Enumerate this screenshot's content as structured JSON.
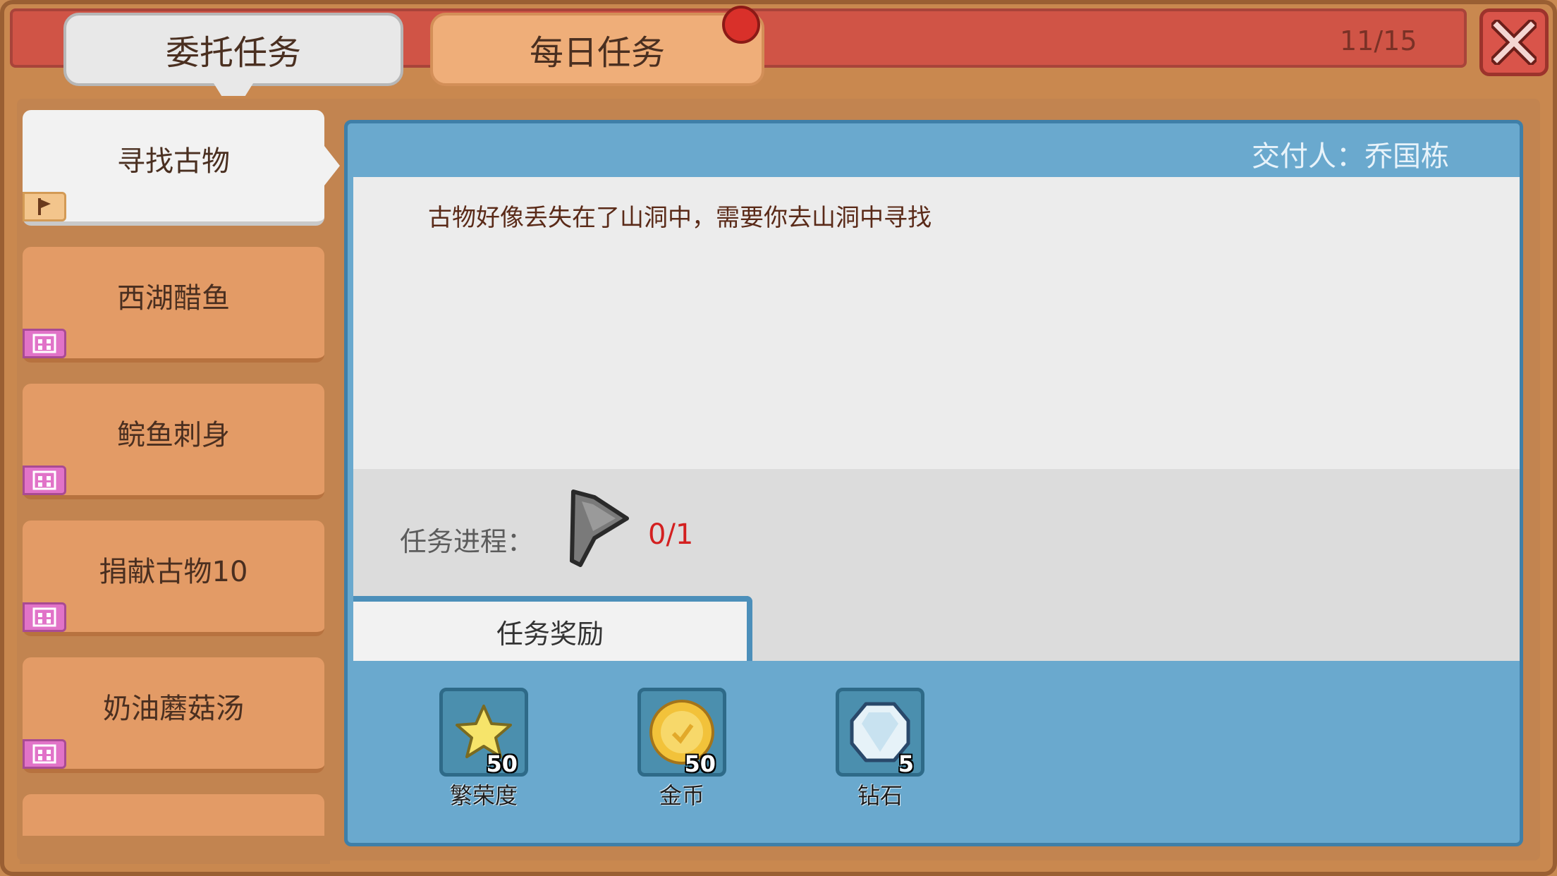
{
  "tabs": {
    "commission": "委托任务",
    "daily": "每日任务"
  },
  "counter": "11/15",
  "quest_list": [
    {
      "label": "寻找古物",
      "tag_icon": "flag-icon",
      "active": true
    },
    {
      "label": "西湖醋鱼",
      "tag_icon": "calendar-icon",
      "active": false
    },
    {
      "label": "鲩鱼刺身",
      "tag_icon": "calendar-icon",
      "active": false
    },
    {
      "label": "捐献古物10",
      "tag_icon": "calendar-icon",
      "active": false
    },
    {
      "label": "奶油蘑菇汤",
      "tag_icon": "calendar-icon",
      "active": false
    }
  ],
  "detail": {
    "giver": "交付人：乔国栋",
    "description": "古物好像丢失在了山洞中，需要你去山洞中寻找",
    "progress_label": "任务进程：",
    "progress_value": "0/1",
    "reward_title": "任务奖励"
  },
  "rewards": [
    {
      "name": "繁荣度",
      "count": "50",
      "icon": "star-icon"
    },
    {
      "name": "金币",
      "count": "50",
      "icon": "gold-coin-icon"
    },
    {
      "name": "钻石",
      "count": "5",
      "icon": "diamond-icon"
    }
  ],
  "colors": {
    "frame": "#c9884f",
    "top_bar": "#d05446",
    "panel": "#6aa9ce",
    "progress_value": "#d32020"
  }
}
